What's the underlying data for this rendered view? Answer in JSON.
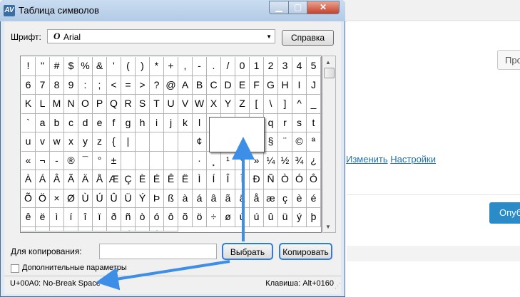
{
  "background": {
    "button_partial": "Про",
    "links": [
      "Изменить",
      "Настройки"
    ],
    "publish_partial": "Опуб"
  },
  "window": {
    "title": "Таблица символов",
    "app_icon": "AV"
  },
  "font": {
    "label": "Шрифт:",
    "selected": "Arial",
    "icon": "opentype-o-icon"
  },
  "help_label": "Справка",
  "grid": {
    "rows": [
      [
        "!",
        "\"",
        "#",
        "$",
        "%",
        "&",
        "'",
        "(",
        ")",
        "*",
        "+",
        ",",
        "-",
        ".",
        "/",
        "0",
        "1",
        "2",
        "3",
        "4"
      ],
      [
        "5",
        "6",
        "7",
        "8",
        "9",
        ":",
        ";",
        "<",
        "=",
        ">",
        "?",
        "@",
        "A",
        "B",
        "C",
        "D",
        "E",
        "F",
        "G",
        "H"
      ],
      [
        "I",
        "J",
        "K",
        "L",
        "M",
        "N",
        "O",
        "P",
        "Q",
        "R",
        "S",
        "T",
        "U",
        "V",
        "W",
        "X",
        "Y",
        "Z",
        "[",
        "\\"
      ],
      [
        "]",
        "^",
        "_",
        "`",
        "a",
        "b",
        "c",
        "d",
        "e",
        "f",
        "g",
        "h",
        "i",
        "j",
        "k",
        "l",
        "m",
        "n",
        "o",
        "p"
      ],
      [
        "q",
        "r",
        "s",
        "t",
        "u",
        "v",
        "w",
        "x",
        "y",
        "z",
        "{",
        "|",
        "",
        "",
        "",
        "",
        "¢",
        "£",
        "¤",
        "¥"
      ],
      [
        "¦",
        "§",
        "¨",
        "©",
        "ª",
        "«",
        "¬",
        "-",
        "®",
        "¯",
        "°",
        "±",
        "",
        "",
        "",
        "",
        "",
        "·",
        "¸",
        "¹"
      ],
      [
        "º",
        "»",
        "¼",
        "½",
        "¾",
        "¿",
        "À",
        "Á",
        "Â",
        "Ã",
        "Ä",
        "Å",
        "Æ",
        "Ç",
        "È",
        "É",
        "Ê",
        "Ë",
        "Ì",
        "Í"
      ],
      [
        "Î",
        "Ï",
        "Ð",
        "Ñ",
        "Ò",
        "Ó",
        "Ô",
        "Õ",
        "Ö",
        "×",
        "Ø",
        "Ù",
        "Ú",
        "Û",
        "Ü",
        "Ý",
        "Þ",
        "ß",
        "à",
        "á"
      ],
      [
        "â",
        "ã",
        "ä",
        "å",
        "æ",
        "ç",
        "è",
        "é",
        "ê",
        "ë",
        "ì",
        "í",
        "î",
        "ï",
        "ð",
        "ñ",
        "ò",
        "ó",
        "ô",
        "õ"
      ],
      [
        "ö",
        "÷",
        "ø",
        "ù",
        "ú",
        "û",
        "ü",
        "ý",
        "þ",
        "ÿ",
        "Ā",
        "ā",
        "Ă",
        "ă",
        "Ą",
        "ą",
        "Ć",
        "ć",
        "Ĉ",
        "ĉ"
      ]
    ]
  },
  "copy": {
    "label": "Для копирования:",
    "value": "",
    "select_label": "Выбрать",
    "copy_label": "Копировать"
  },
  "advanced_label": "Дополнительные параметры",
  "status": {
    "left": "U+00A0: No-Break Space",
    "right": "Клавиша: Alt+0160"
  },
  "colors": {
    "highlight": "#2f7be0",
    "arrow": "#3d8ee6"
  }
}
